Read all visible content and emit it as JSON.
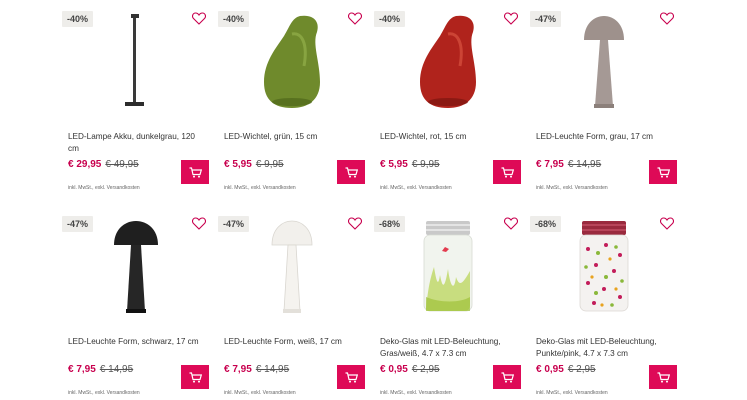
{
  "products": [
    {
      "badge": "-40%",
      "name": "LED-Lampe Akku, dunkelgrau, 120 cm",
      "price": "€ 29,95",
      "old_price": "€ 49,95",
      "note": "inkl. MwSt., exkl. Versandkosten",
      "image": "floor-lamp"
    },
    {
      "badge": "-40%",
      "name": "LED-Wichtel, grün, 15 cm",
      "price": "€ 5,95",
      "old_price": "€ 9,95",
      "note": "inkl. MwSt., exkl. Versandkosten",
      "image": "gnome-green",
      "color": "#6f8a2c"
    },
    {
      "badge": "-40%",
      "name": "LED-Wichtel, rot, 15 cm",
      "price": "€ 5,95",
      "old_price": "€ 9,95",
      "note": "inkl. MwSt., exkl. Versandkosten",
      "image": "gnome-red",
      "color": "#b0231c"
    },
    {
      "badge": "-47%",
      "name": "LED-Leuchte Form, grau, 17 cm",
      "price": "€ 7,95",
      "old_price": "€ 14,95",
      "note": "inkl. MwSt., exkl. Versandkosten",
      "image": "mushroom-lamp",
      "color": "#9e918c"
    },
    {
      "badge": "-47%",
      "name": "LED-Leuchte Form, schwarz, 17 cm",
      "price": "€ 7,95",
      "old_price": "€ 14,95",
      "note": "inkl. MwSt., exkl. Versandkosten",
      "image": "mushroom-lamp",
      "color": "#222222"
    },
    {
      "badge": "-47%",
      "name": "LED-Leuchte Form, weiß, 17 cm",
      "price": "€ 7,95",
      "old_price": "€ 14,95",
      "note": "inkl. MwSt., exkl. Versandkosten",
      "image": "mushroom-lamp",
      "color": "#f2f0ec"
    },
    {
      "badge": "-68%",
      "name": "Deko-Glas mit LED-Beleuchtung, Gras/weiß, 4.7 x 7.3 cm",
      "price": "€ 0,95",
      "old_price": "€ 2,95",
      "note": "inkl. MwSt., exkl. Versandkosten",
      "image": "jar-grass"
    },
    {
      "badge": "-68%",
      "name": "Deko-Glas mit LED-Beleuchtung, Punkte/pink, 4.7 x 7.3 cm",
      "price": "€ 0,95",
      "old_price": "€ 2,95",
      "note": "inkl. MwSt., exkl. Versandkosten",
      "image": "jar-dots"
    }
  ],
  "colors": {
    "accent": "#de0a57",
    "price": "#c8004e",
    "badge_bg": "#eeedea"
  },
  "icons": {
    "wishlist": "heart-icon",
    "cart": "cart-icon"
  }
}
